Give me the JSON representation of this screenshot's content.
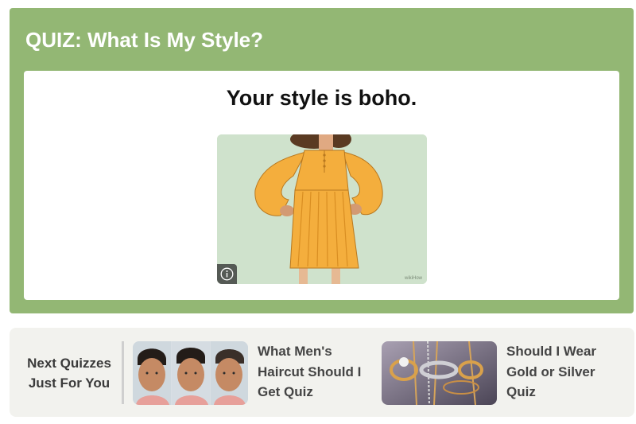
{
  "quiz": {
    "title": "QUIZ: What Is My Style?",
    "result_heading": "Your style is boho.",
    "image_watermark": "wikiHow"
  },
  "next_quizzes": {
    "label": "Next Quizzes Just For You",
    "items": [
      {
        "title": "What Men's Haircut Should I Get Quiz"
      },
      {
        "title": "Should I Wear Gold or Silver Quiz"
      }
    ]
  },
  "colors": {
    "card_green": "#93b774",
    "dress_yellow": "#f4ae3d",
    "panel_bg": "#f2f2ee"
  },
  "icons": {
    "info": "info-icon"
  }
}
